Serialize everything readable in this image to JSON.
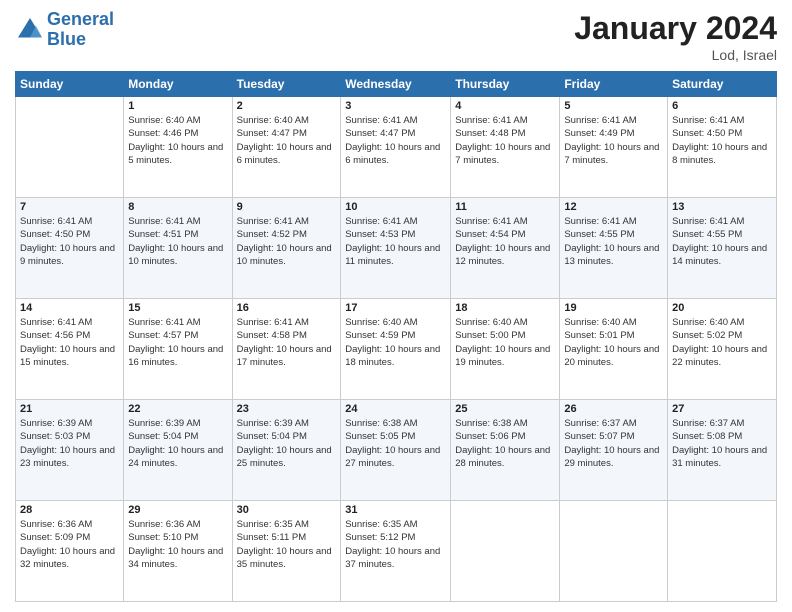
{
  "header": {
    "logo_line1": "General",
    "logo_line2": "Blue",
    "title": "January 2024",
    "subtitle": "Lod, Israel"
  },
  "weekdays": [
    "Sunday",
    "Monday",
    "Tuesday",
    "Wednesday",
    "Thursday",
    "Friday",
    "Saturday"
  ],
  "weeks": [
    [
      null,
      {
        "day": "1",
        "sunrise": "6:40 AM",
        "sunset": "4:46 PM",
        "daylight": "10 hours and 5 minutes."
      },
      {
        "day": "2",
        "sunrise": "6:40 AM",
        "sunset": "4:47 PM",
        "daylight": "10 hours and 6 minutes."
      },
      {
        "day": "3",
        "sunrise": "6:41 AM",
        "sunset": "4:47 PM",
        "daylight": "10 hours and 6 minutes."
      },
      {
        "day": "4",
        "sunrise": "6:41 AM",
        "sunset": "4:48 PM",
        "daylight": "10 hours and 7 minutes."
      },
      {
        "day": "5",
        "sunrise": "6:41 AM",
        "sunset": "4:49 PM",
        "daylight": "10 hours and 7 minutes."
      },
      {
        "day": "6",
        "sunrise": "6:41 AM",
        "sunset": "4:50 PM",
        "daylight": "10 hours and 8 minutes."
      }
    ],
    [
      {
        "day": "7",
        "sunrise": "6:41 AM",
        "sunset": "4:50 PM",
        "daylight": "10 hours and 9 minutes."
      },
      {
        "day": "8",
        "sunrise": "6:41 AM",
        "sunset": "4:51 PM",
        "daylight": "10 hours and 10 minutes."
      },
      {
        "day": "9",
        "sunrise": "6:41 AM",
        "sunset": "4:52 PM",
        "daylight": "10 hours and 10 minutes."
      },
      {
        "day": "10",
        "sunrise": "6:41 AM",
        "sunset": "4:53 PM",
        "daylight": "10 hours and 11 minutes."
      },
      {
        "day": "11",
        "sunrise": "6:41 AM",
        "sunset": "4:54 PM",
        "daylight": "10 hours and 12 minutes."
      },
      {
        "day": "12",
        "sunrise": "6:41 AM",
        "sunset": "4:55 PM",
        "daylight": "10 hours and 13 minutes."
      },
      {
        "day": "13",
        "sunrise": "6:41 AM",
        "sunset": "4:55 PM",
        "daylight": "10 hours and 14 minutes."
      }
    ],
    [
      {
        "day": "14",
        "sunrise": "6:41 AM",
        "sunset": "4:56 PM",
        "daylight": "10 hours and 15 minutes."
      },
      {
        "day": "15",
        "sunrise": "6:41 AM",
        "sunset": "4:57 PM",
        "daylight": "10 hours and 16 minutes."
      },
      {
        "day": "16",
        "sunrise": "6:41 AM",
        "sunset": "4:58 PM",
        "daylight": "10 hours and 17 minutes."
      },
      {
        "day": "17",
        "sunrise": "6:40 AM",
        "sunset": "4:59 PM",
        "daylight": "10 hours and 18 minutes."
      },
      {
        "day": "18",
        "sunrise": "6:40 AM",
        "sunset": "5:00 PM",
        "daylight": "10 hours and 19 minutes."
      },
      {
        "day": "19",
        "sunrise": "6:40 AM",
        "sunset": "5:01 PM",
        "daylight": "10 hours and 20 minutes."
      },
      {
        "day": "20",
        "sunrise": "6:40 AM",
        "sunset": "5:02 PM",
        "daylight": "10 hours and 22 minutes."
      }
    ],
    [
      {
        "day": "21",
        "sunrise": "6:39 AM",
        "sunset": "5:03 PM",
        "daylight": "10 hours and 23 minutes."
      },
      {
        "day": "22",
        "sunrise": "6:39 AM",
        "sunset": "5:04 PM",
        "daylight": "10 hours and 24 minutes."
      },
      {
        "day": "23",
        "sunrise": "6:39 AM",
        "sunset": "5:04 PM",
        "daylight": "10 hours and 25 minutes."
      },
      {
        "day": "24",
        "sunrise": "6:38 AM",
        "sunset": "5:05 PM",
        "daylight": "10 hours and 27 minutes."
      },
      {
        "day": "25",
        "sunrise": "6:38 AM",
        "sunset": "5:06 PM",
        "daylight": "10 hours and 28 minutes."
      },
      {
        "day": "26",
        "sunrise": "6:37 AM",
        "sunset": "5:07 PM",
        "daylight": "10 hours and 29 minutes."
      },
      {
        "day": "27",
        "sunrise": "6:37 AM",
        "sunset": "5:08 PM",
        "daylight": "10 hours and 31 minutes."
      }
    ],
    [
      {
        "day": "28",
        "sunrise": "6:36 AM",
        "sunset": "5:09 PM",
        "daylight": "10 hours and 32 minutes."
      },
      {
        "day": "29",
        "sunrise": "6:36 AM",
        "sunset": "5:10 PM",
        "daylight": "10 hours and 34 minutes."
      },
      {
        "day": "30",
        "sunrise": "6:35 AM",
        "sunset": "5:11 PM",
        "daylight": "10 hours and 35 minutes."
      },
      {
        "day": "31",
        "sunrise": "6:35 AM",
        "sunset": "5:12 PM",
        "daylight": "10 hours and 37 minutes."
      },
      null,
      null,
      null
    ]
  ],
  "labels": {
    "sunrise": "Sunrise:",
    "sunset": "Sunset:",
    "daylight": "Daylight:"
  }
}
